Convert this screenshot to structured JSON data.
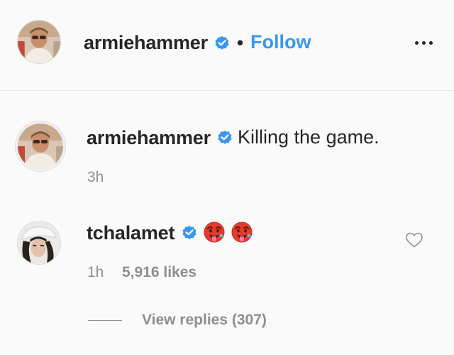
{
  "colors": {
    "background": "#fafafa",
    "text": "#262626",
    "muted": "#8e8e8e",
    "link": "#3897f0",
    "verified": "#3897f0",
    "divider": "#e6e6e6"
  },
  "header": {
    "username": "armiehammer",
    "separator": "•",
    "follow_label": "Follow",
    "avatar_icon": "profile-photo-armiehammer",
    "verified_icon": "verified-badge-icon",
    "more_icon": "more-options-icon"
  },
  "caption": {
    "username": "armiehammer",
    "text": "Killing the game.",
    "time": "3h",
    "verified_icon": "verified-badge-icon"
  },
  "comment": {
    "username": "tchalamet",
    "emojis": [
      "hot-face-emoji",
      "hot-face-emoji"
    ],
    "time": "1h",
    "likes": "5,916 likes",
    "heart_icon": "heart-outline-icon",
    "verified_icon": "verified-badge-icon"
  },
  "replies": {
    "label": "View replies (307)"
  }
}
